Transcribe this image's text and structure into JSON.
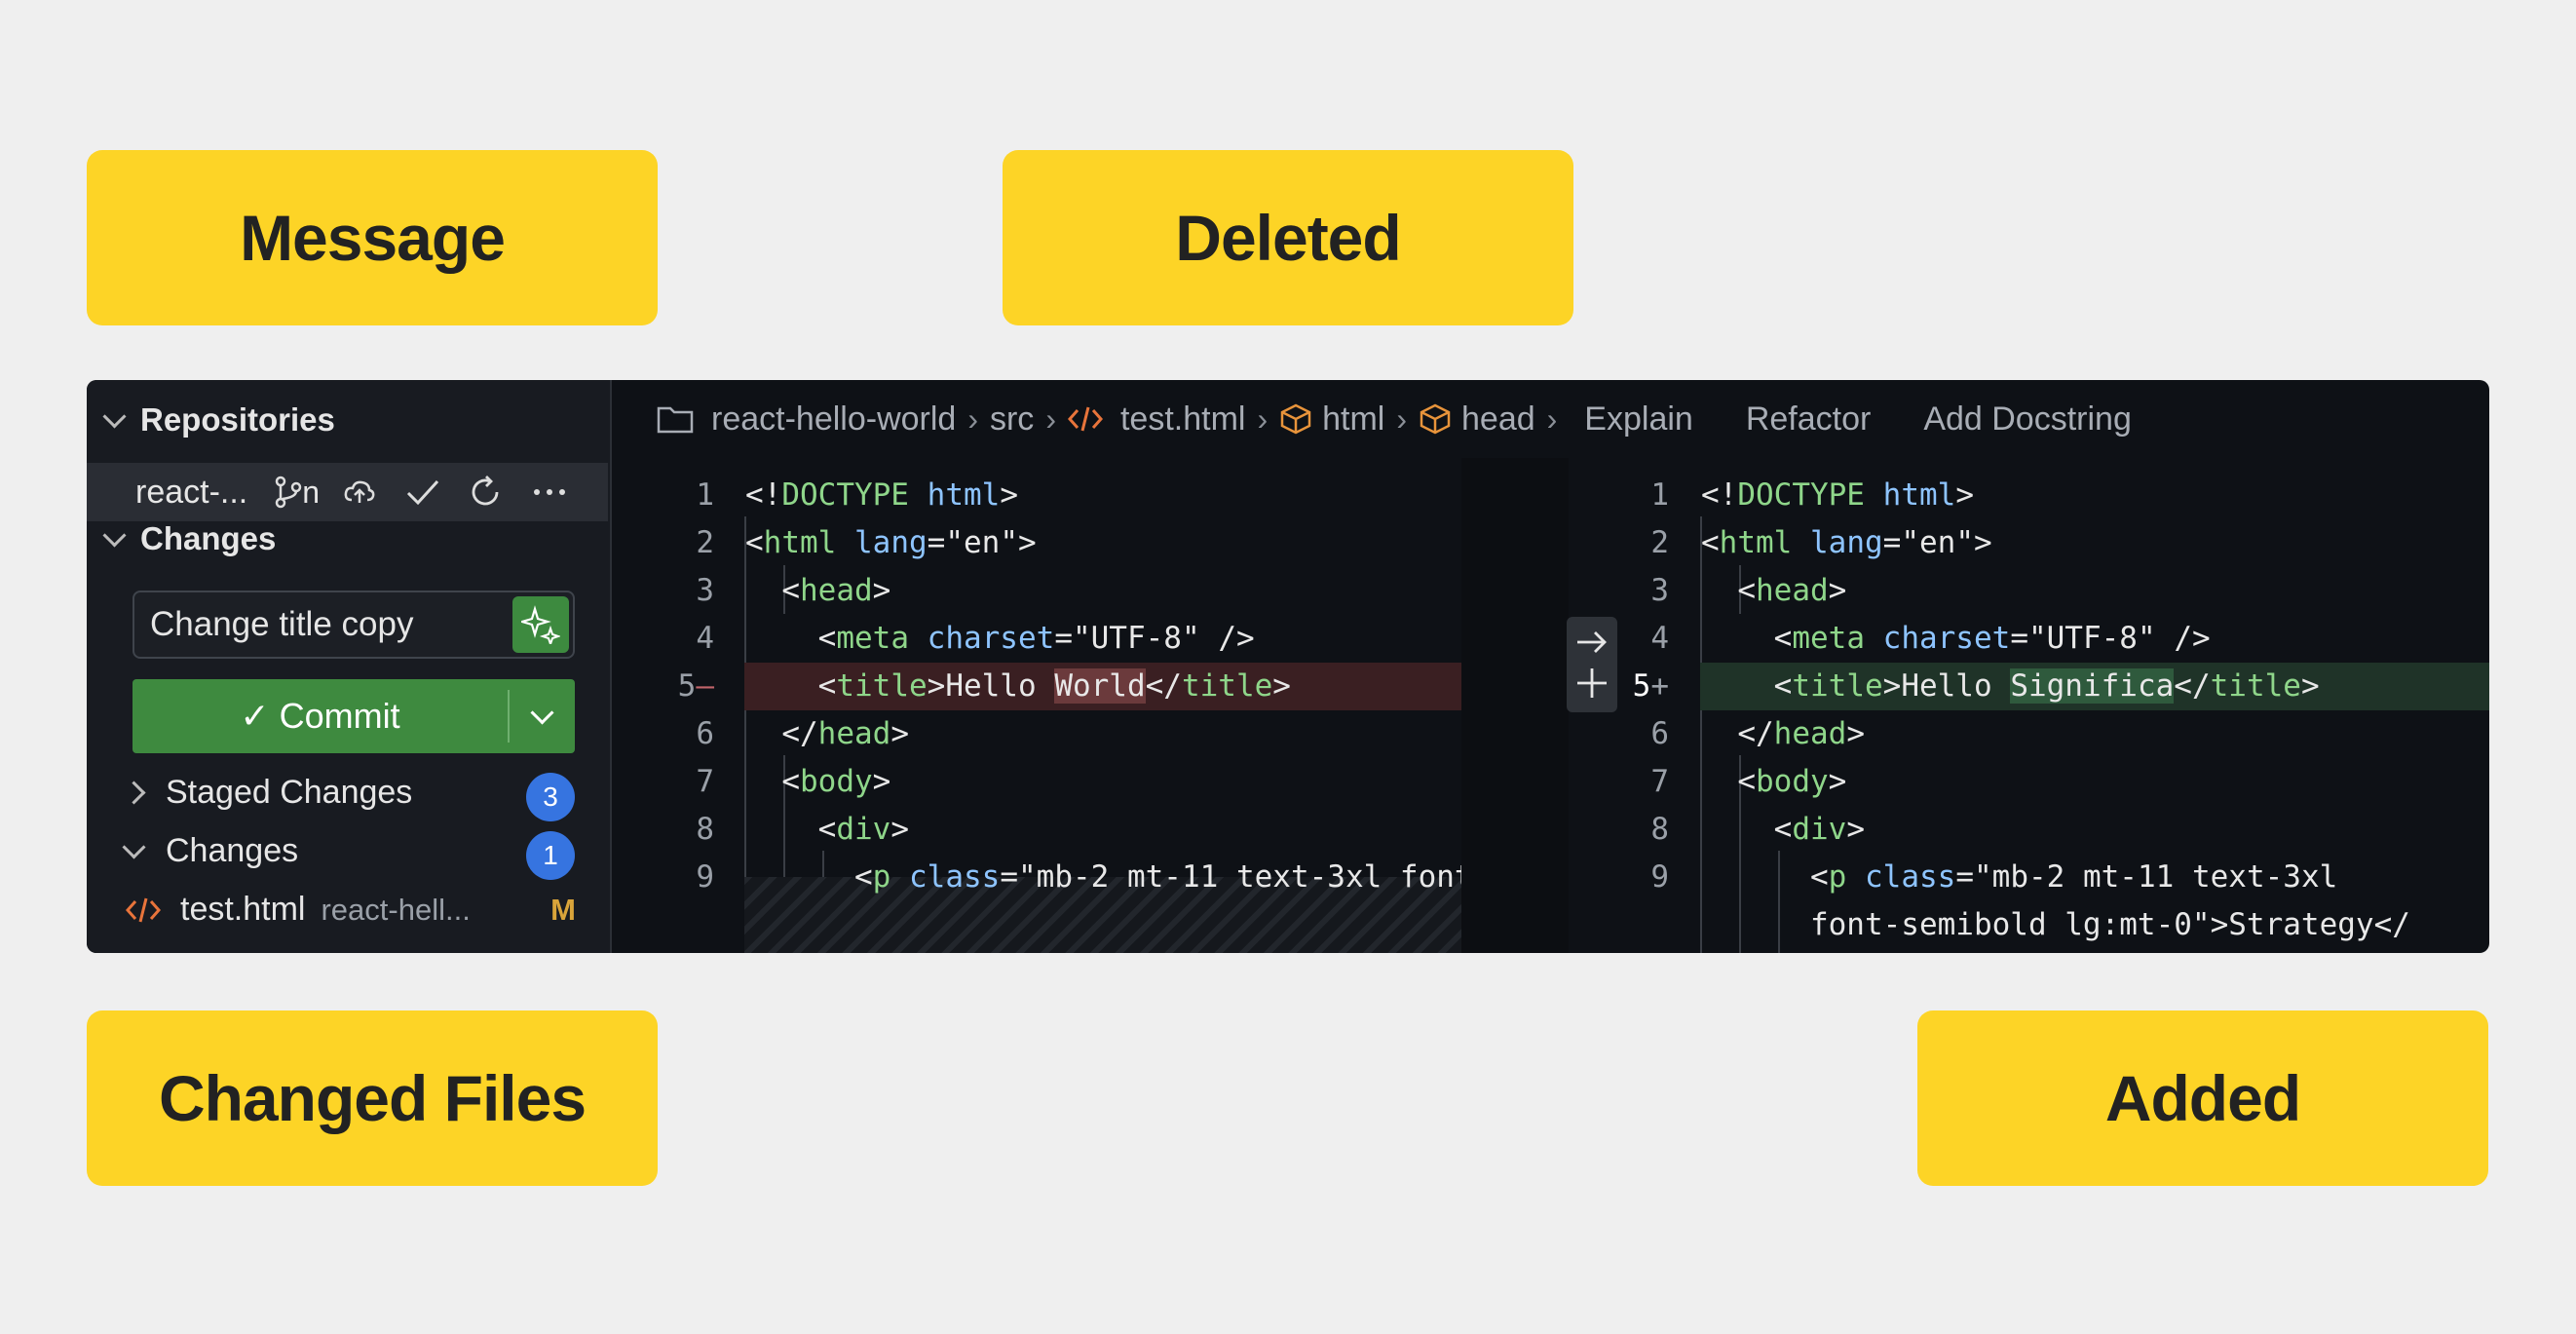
{
  "callouts": {
    "message": "Message",
    "deleted": "Deleted",
    "changed_files": "Changed Files",
    "added": "Added"
  },
  "sidebar": {
    "repositories_label": "Repositories",
    "repo_name": "react-...",
    "branch_name": "n",
    "changes_section_label": "Changes",
    "commit_message": "Change title copy",
    "commit_label": "✓ Commit",
    "staged_label": "Staged Changes",
    "staged_count": "3",
    "changes_label": "Changes",
    "changes_count": "1",
    "file": {
      "name": "test.html",
      "path": "react-hell...",
      "status": "M"
    }
  },
  "breadcrumb": {
    "repo": "react-hello-world",
    "folder": "src",
    "file": "test.html",
    "sym1": "html",
    "sym2": "head",
    "action1": "Explain",
    "action2": "Refactor",
    "action3": "Add Docstring"
  },
  "left_pane": {
    "line_numbers": [
      "1",
      "2",
      "3",
      "4",
      "5",
      "6",
      "7",
      "8",
      "9"
    ]
  },
  "right_pane": {
    "line_numbers": [
      "1",
      "2",
      "3",
      "4",
      "5",
      "6",
      "7",
      "8",
      "9"
    ]
  },
  "colors": {
    "callout_bg": "#fdd426",
    "commit_green": "#3e8a3f",
    "badge_blue": "#3674e0",
    "deleted_bg": "#3a1f22",
    "added_bg": "#1f3328",
    "modified_status": "#d9a43a",
    "html_icon": "#e8743b"
  },
  "icons": [
    "chevron-down-icon",
    "chevron-right-icon",
    "branch-icon",
    "cloud-upload-icon",
    "check-icon",
    "refresh-icon",
    "more-icon",
    "sparkle-icon",
    "folder-icon",
    "code-icon",
    "cube-icon",
    "arrow-right-icon",
    "plus-icon"
  ]
}
